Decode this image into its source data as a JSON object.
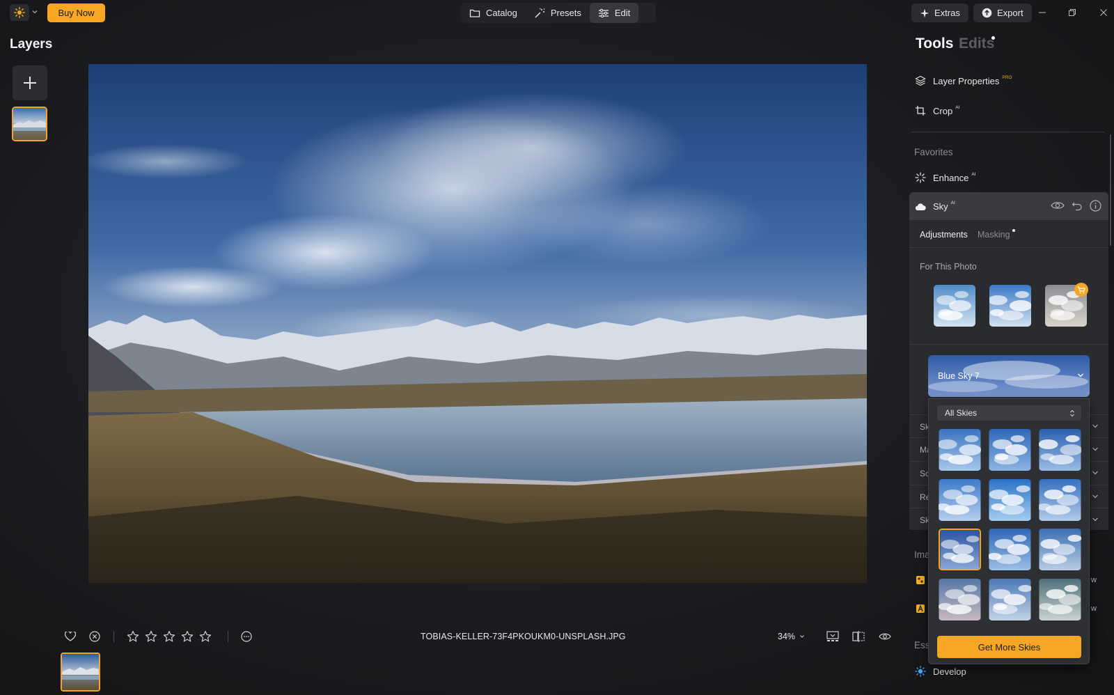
{
  "topbar": {
    "buy_label": "Buy Now",
    "nav": [
      "Catalog",
      "Presets",
      "Edit"
    ],
    "extras_label": "Extras",
    "export_label": "Export"
  },
  "layers": {
    "title": "Layers"
  },
  "photo": {
    "filename": "TOBIAS-KELLER-73F4PKOUKM0-UNSPLASH.JPG",
    "zoom": "34%"
  },
  "rating": {
    "stars": 0,
    "max": 5
  },
  "panel": {
    "tab_tools": "Tools",
    "tab_edits": "Edits",
    "layer_properties": "Layer Properties",
    "layer_properties_badge": "PRO",
    "crop": "Crop",
    "crop_badge": "AI",
    "favorites": "Favorites",
    "enhance": "Enhance",
    "enhance_badge": "AI",
    "sky": "Sky",
    "sky_badge": "AI",
    "sub_adjustments": "Adjustments",
    "sub_masking": "Masking",
    "for_this_photo": "For This Photo",
    "selected_sky": "Blue Sky 7",
    "collapsed_rows": [
      "Sk",
      "Ma",
      "Sc",
      "Re",
      "Sk"
    ],
    "image_section": "Ima",
    "ess_section": "Ess",
    "develop": "Develop",
    "partial_w1": "w",
    "partial_w2": "w"
  },
  "sky_popup": {
    "filter": "All Skies",
    "get_more": "Get More Skies",
    "selected_index": 6
  },
  "colors": {
    "accent": "#f5a623",
    "panel": "#2a2b2f",
    "header": "#3a3b40"
  }
}
